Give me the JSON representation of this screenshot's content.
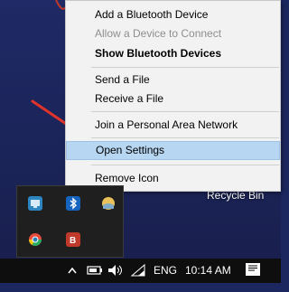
{
  "context_menu": {
    "items": [
      {
        "label": "Add a Bluetooth Device",
        "state": "normal"
      },
      {
        "label": "Allow a Device to Connect",
        "state": "disabled"
      },
      {
        "label": "Show Bluetooth Devices",
        "state": "bold"
      },
      {
        "label": "Send a File",
        "state": "normal"
      },
      {
        "label": "Receive a File",
        "state": "normal"
      },
      {
        "label": "Join a Personal Area Network",
        "state": "normal"
      },
      {
        "label": "Open Settings",
        "state": "highlighted"
      },
      {
        "label": "Remove Icon",
        "state": "normal"
      }
    ]
  },
  "desktop": {
    "recycle_bin_label": "Recycle Bin"
  },
  "tray_overflow": {
    "icons": [
      "network-tool-icon",
      "bluetooth-icon",
      "weather-icon",
      "chrome-icon",
      "antivirus-icon"
    ]
  },
  "taskbar": {
    "language": "ENG",
    "time": "10:14 AM"
  },
  "colors": {
    "menu_highlight": "#b6d6f2",
    "arrow": "#e0332a",
    "desktop": "#1f2a66"
  }
}
